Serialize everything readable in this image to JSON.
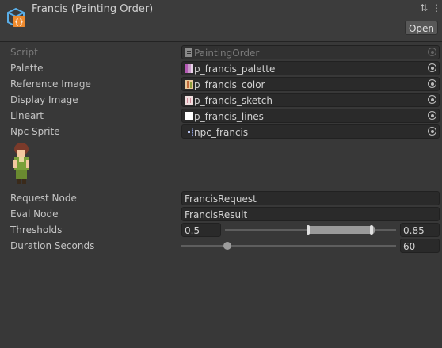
{
  "header": {
    "title": "Francis (Painting Order)",
    "open_label": "Open",
    "settings_glyph": "⇅",
    "menu_glyph": "⋮"
  },
  "fields": [
    {
      "label": "Script",
      "value": "PaintingOrder",
      "icon": "script-icon"
    },
    {
      "label": "Palette",
      "value": "p_francis_palette",
      "icon": "palette-texture-icon"
    },
    {
      "label": "Reference Image",
      "value": "p_francis_color",
      "icon": "color-texture-icon"
    },
    {
      "label": "Display Image",
      "value": "p_francis_sketch",
      "icon": "sketch-texture-icon"
    },
    {
      "label": "Lineart",
      "value": "p_francis_lines",
      "icon": "lines-texture-icon"
    },
    {
      "label": "Npc Sprite",
      "value": "npc_francis",
      "icon": "sprite-icon"
    }
  ],
  "request_node": {
    "label": "Request Node",
    "value": "FrancisRequest"
  },
  "eval_node": {
    "label": "Eval Node",
    "value": "FrancisResult"
  },
  "thresholds": {
    "label": "Thresholds",
    "min": "0.5",
    "max": "0.85"
  },
  "duration": {
    "label": "Duration Seconds",
    "value": "60",
    "slider_fraction": 0.25
  },
  "colors": {
    "background": "#383838",
    "field": "#2a2a2a",
    "text": "#c4c4c4",
    "icon_blue": "#5aaee8",
    "icon_orange": "#ee8a2e"
  }
}
